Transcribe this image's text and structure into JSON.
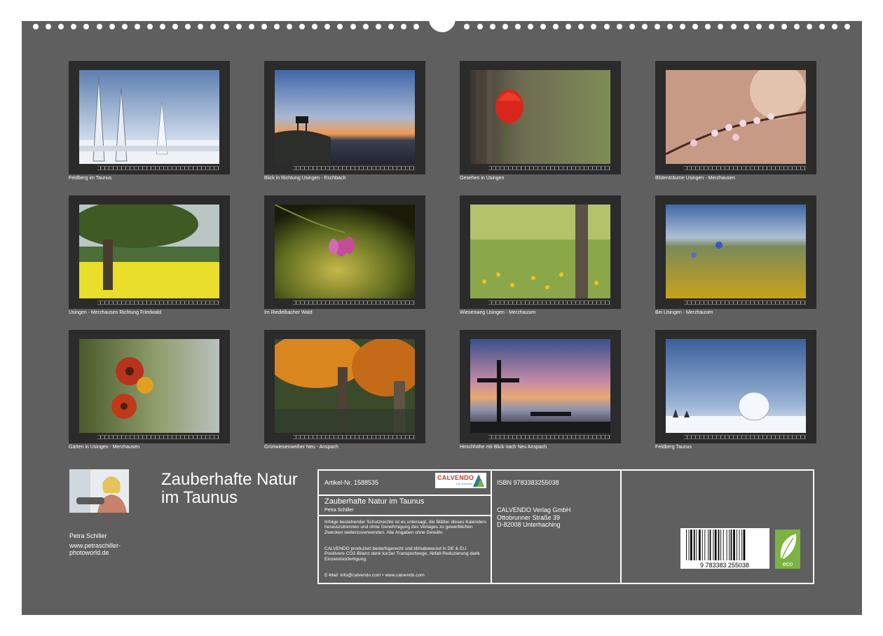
{
  "tiles": [
    {
      "caption": "Feldberg im Taunus"
    },
    {
      "caption": "Blick in Richtung Usingen - Eschbach"
    },
    {
      "caption": "Gesehen in Usingen"
    },
    {
      "caption": "Blütenträume Usingen - Merzhausen"
    },
    {
      "caption": "Usingen - Merzhausen Richtung Friedwald"
    },
    {
      "caption": "Im Riedelbacher Wald"
    },
    {
      "caption": "Wiesenweg Usingen - Merzhausen"
    },
    {
      "caption": "Bei Usingen - Merzhausen"
    },
    {
      "caption": "Gärten in Usingen - Merzhausen"
    },
    {
      "caption": "Grünwiesenweiher Neu - Anspach"
    },
    {
      "caption": "Hirschhöhe mit Blick nach Neu Anspach"
    },
    {
      "caption": "Feldberg Taunus"
    }
  ],
  "calendar": {
    "title_line1": "Zauberhafte Natur",
    "title_line2": "im Taunus",
    "author": "Petra Schiller",
    "website": "www.petraschiller-photoworld.de"
  },
  "info": {
    "article": "Artikel-Nr. 1588535",
    "logo_word": "CALVENDO",
    "logo_tag": "Der Kalender-Verlag",
    "product_title": "Zauberhafte Natur im Taunus",
    "product_author": "Petra Schiller",
    "legal": "Infolge bestehender Schutzrechte ist es untersagt, die Blätter dieses Kalenders herauszutrennen und ohne Genehmigung des Verlages zu gewerblichen Zwecken weiterzuverwenden. Alle Angaben ohne Gewähr.",
    "eco_text": "CALVENDO produziert bedarfsgerecht und klimabewusst in DE & EU. Positivere CO2-Bilanz dank kurzer Transportwege. Abfall-Reduzierung dank Einzelstückfertigung.",
    "contact": "E-Mail: info@calvendo.com • www.calvendo.com",
    "isbn": "ISBN 9783383255038",
    "publisher_name": "CALVENDO Verlag GmbH",
    "publisher_street": "Ottobrunner Straße 39",
    "publisher_city": "D-82008 Unterhaching",
    "barcode_digits": "9 783383 255038",
    "eco_label": "eco"
  },
  "colors": {
    "board": "#5f5f5f",
    "tile_frame": "#2b2b2b",
    "text": "#ffffff",
    "calvendo_red": "#c0392b",
    "eco_green": "#7cb342"
  }
}
